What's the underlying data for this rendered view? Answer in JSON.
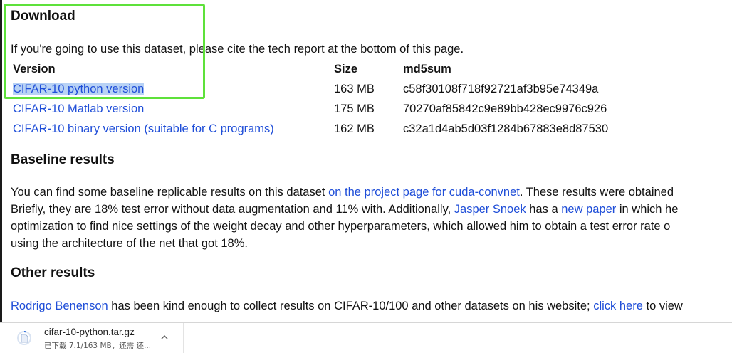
{
  "download_section": {
    "heading": "Download",
    "intro": "If you're going to use this dataset, please cite the tech report at the bottom of this page.",
    "table": {
      "headers": [
        "Version",
        "Size",
        "md5sum"
      ],
      "rows": [
        {
          "version": "CIFAR-10 python version",
          "size": "163 MB",
          "md5": "c58f30108f718f92721af3b95e74349a",
          "highlighted": true
        },
        {
          "version": "CIFAR-10 Matlab version",
          "size": "175 MB",
          "md5": "70270af85842c9e89bb428ec9976c926"
        },
        {
          "version": "CIFAR-10 binary version (suitable for C programs)",
          "size": "162 MB",
          "md5": "c32a1d4ab5d03f1284b67883e8d87530"
        }
      ]
    }
  },
  "baseline_section": {
    "heading": "Baseline results",
    "line1_pre": "You can find some baseline replicable results on this dataset ",
    "line1_link": "on the project page for cuda-convnet",
    "line1_post": ". These results were obtained",
    "line2_pre": "Briefly, they are 18% test error without data augmentation and 11% with. Additionally, ",
    "line2_link1": "Jasper Snoek",
    "line2_mid": " has a ",
    "line2_link2": "new paper",
    "line2_post": " in which he",
    "line3": "optimization to find nice settings of the weight decay and other hyperparameters, which allowed him to obtain a test error rate o",
    "line4": "using the architecture of the net that got 18%."
  },
  "other_section": {
    "heading": "Other results",
    "link1": "Rodrigo Benenson",
    "mid": " has been kind enough to collect results on CIFAR-10/100 and other datasets on his website; ",
    "link2": "click here",
    "post": " to view"
  },
  "download_bar": {
    "filename": "cifar-10-python.tar.gz",
    "status": "已下载 7.1/163 MB，还需 还...",
    "progress": 0.0436,
    "icon": "download-progress-icon",
    "menu_icon": "chevron-up-icon"
  },
  "colors": {
    "link": "#1f4ed8",
    "selection": "#b8d2f5",
    "annotation_box": "#5ee13a"
  }
}
